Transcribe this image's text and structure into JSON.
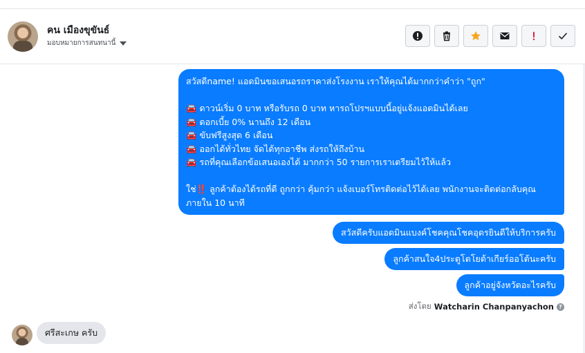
{
  "header": {
    "contact_name": "คน เมืองขุขันธ์",
    "assign_label": "มอบหมายการสนทนานี้",
    "actions": [
      {
        "name": "mark-spam",
        "icon": "exclamation-circle-icon"
      },
      {
        "name": "delete",
        "icon": "trash-icon"
      },
      {
        "name": "star",
        "icon": "star-icon"
      },
      {
        "name": "mark-unread",
        "icon": "envelope-icon"
      },
      {
        "name": "follow-up",
        "icon": "exclamation-icon"
      },
      {
        "name": "mark-done",
        "icon": "check-icon"
      }
    ],
    "colors": {
      "star": "#f5a623",
      "exclamation": "#e41e3f"
    }
  },
  "messages": {
    "outgoing_main": {
      "lines": [
        "สวัสดีname! แอดมินขอเสนอรถราคาส่งโรงงาน เราให้คุณได้มากกว่าคำว่า \"ถูก\"",
        "",
        "🚘 ดาวน์เริ่ม 0 บาท หรือรับรถ 0 บาท หารถโปรฯแบบนี้อยู่แจ้งแอดมินได้เลย",
        "🚘 ดอกเบี้ย 0% นานถึง 12 เดือน",
        "🚘 ขับฟรีสูงสุด 6 เดือน",
        "🚘 ออกได้ทั่วไทย จัดได้ทุกอาชีพ ส่งรถให้ถึงบ้าน",
        "🚘 รถที่คุณเลือกข้อเสนอเองได้ มากกว่า 50 รายการเราเตรียมไว้ให้แล้ว",
        "",
        "ใช่‼️ ลูกค้าต้องได้รถที่ดี ถูกกว่า คุ้มกว่า แจ้งเบอร์โทรติดต่อไว้ได้เลย พนักงานจะติดต่อกลับคุณภายใน 10 นาที"
      ]
    },
    "outgoing_1": "สวัสดีครับแอดมินแบงค์โชคคุณโชคอุดรยินดีให้บริการครับ",
    "outgoing_2": "ลูกค้าสนใจ4ประตูโตโยต้าเกียร์ออโต้นะครับ",
    "outgoing_3": "ลูกค้าอยู่จังหวัดอะไรครับ",
    "sent_by_prefix": "ส่งโดย",
    "sent_by_name": "Watcharin Chanpanyachon",
    "incoming_1": "ศรีสะเกษ ครับ"
  },
  "colors": {
    "bubble_outgoing": "#0a7cff",
    "bubble_incoming": "#e4e6eb"
  }
}
